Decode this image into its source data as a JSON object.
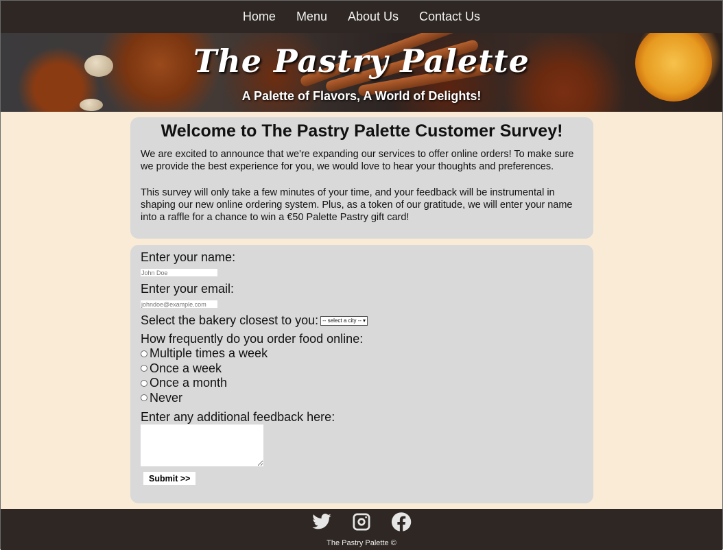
{
  "nav": {
    "items": [
      {
        "label": "Home"
      },
      {
        "label": "Menu"
      },
      {
        "label": "About Us"
      },
      {
        "label": "Contact Us"
      }
    ]
  },
  "banner": {
    "title": "The Pastry Palette",
    "subtitle": "A Palette of Flavors, A World of Delights!"
  },
  "intro": {
    "heading": "Welcome to The Pastry Palette Customer Survey!",
    "p1": "We are excited to announce that we're expanding our services to offer online orders! To make sure we provide the best experience for you, we would love to hear your thoughts and preferences.",
    "p2": "This survey will only take a few minutes of your time, and your feedback will be instrumental in shaping our new online ordering system. Plus, as a token of our gratitude, we will enter your name into a raffle for a chance to win a €50 Palette Pastry gift card!"
  },
  "form": {
    "name_label": "Enter your name:",
    "name_placeholder": "John Doe",
    "email_label": "Enter your email:",
    "email_placeholder": "johndoe@example.com",
    "bakery_label": "Select the bakery closest to you:",
    "bakery_selected": "-- select a city --",
    "frequency_label": "How frequently do you order food online:",
    "frequency_options": [
      {
        "label": "Multiple times a week"
      },
      {
        "label": "Once a week"
      },
      {
        "label": "Once a month"
      },
      {
        "label": "Never"
      }
    ],
    "feedback_label": "Enter any additional feedback here:",
    "submit_label": "Submit >>"
  },
  "footer": {
    "icons": [
      "twitter-icon",
      "instagram-icon",
      "facebook-icon"
    ],
    "copyright": "The Pastry Palette ©"
  },
  "colors": {
    "nav_bg": "#2e2723",
    "page_bg": "#faebd7",
    "card_bg": "#d9d9d9"
  }
}
